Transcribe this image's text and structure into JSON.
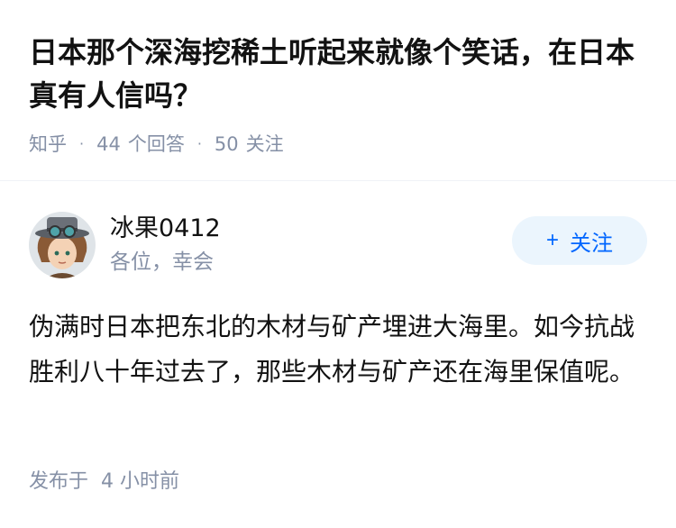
{
  "question": {
    "title": "日本那个深海挖稀土听起来就像个笑话，在日本真有人信吗？",
    "source": "知乎",
    "answers_count": "44",
    "answers_label": "个回答",
    "followers_count": "50",
    "followers_label": "关注"
  },
  "answer": {
    "author_name": "冰果0412",
    "author_bio": "各位，幸会",
    "follow_button": {
      "plus": "+",
      "label": "关注"
    },
    "content": "伪满时日本把东北的木材与矿产埋进大海里。如今抗战胜利八十年过去了，那些木材与矿产还在海里保值呢。",
    "posted_label": "发布于",
    "posted_time": "4 小时前"
  },
  "colors": {
    "accent": "#0066ff",
    "button_bg": "#ebf5fd",
    "meta_text": "#8590a6",
    "title_text": "#121212"
  }
}
